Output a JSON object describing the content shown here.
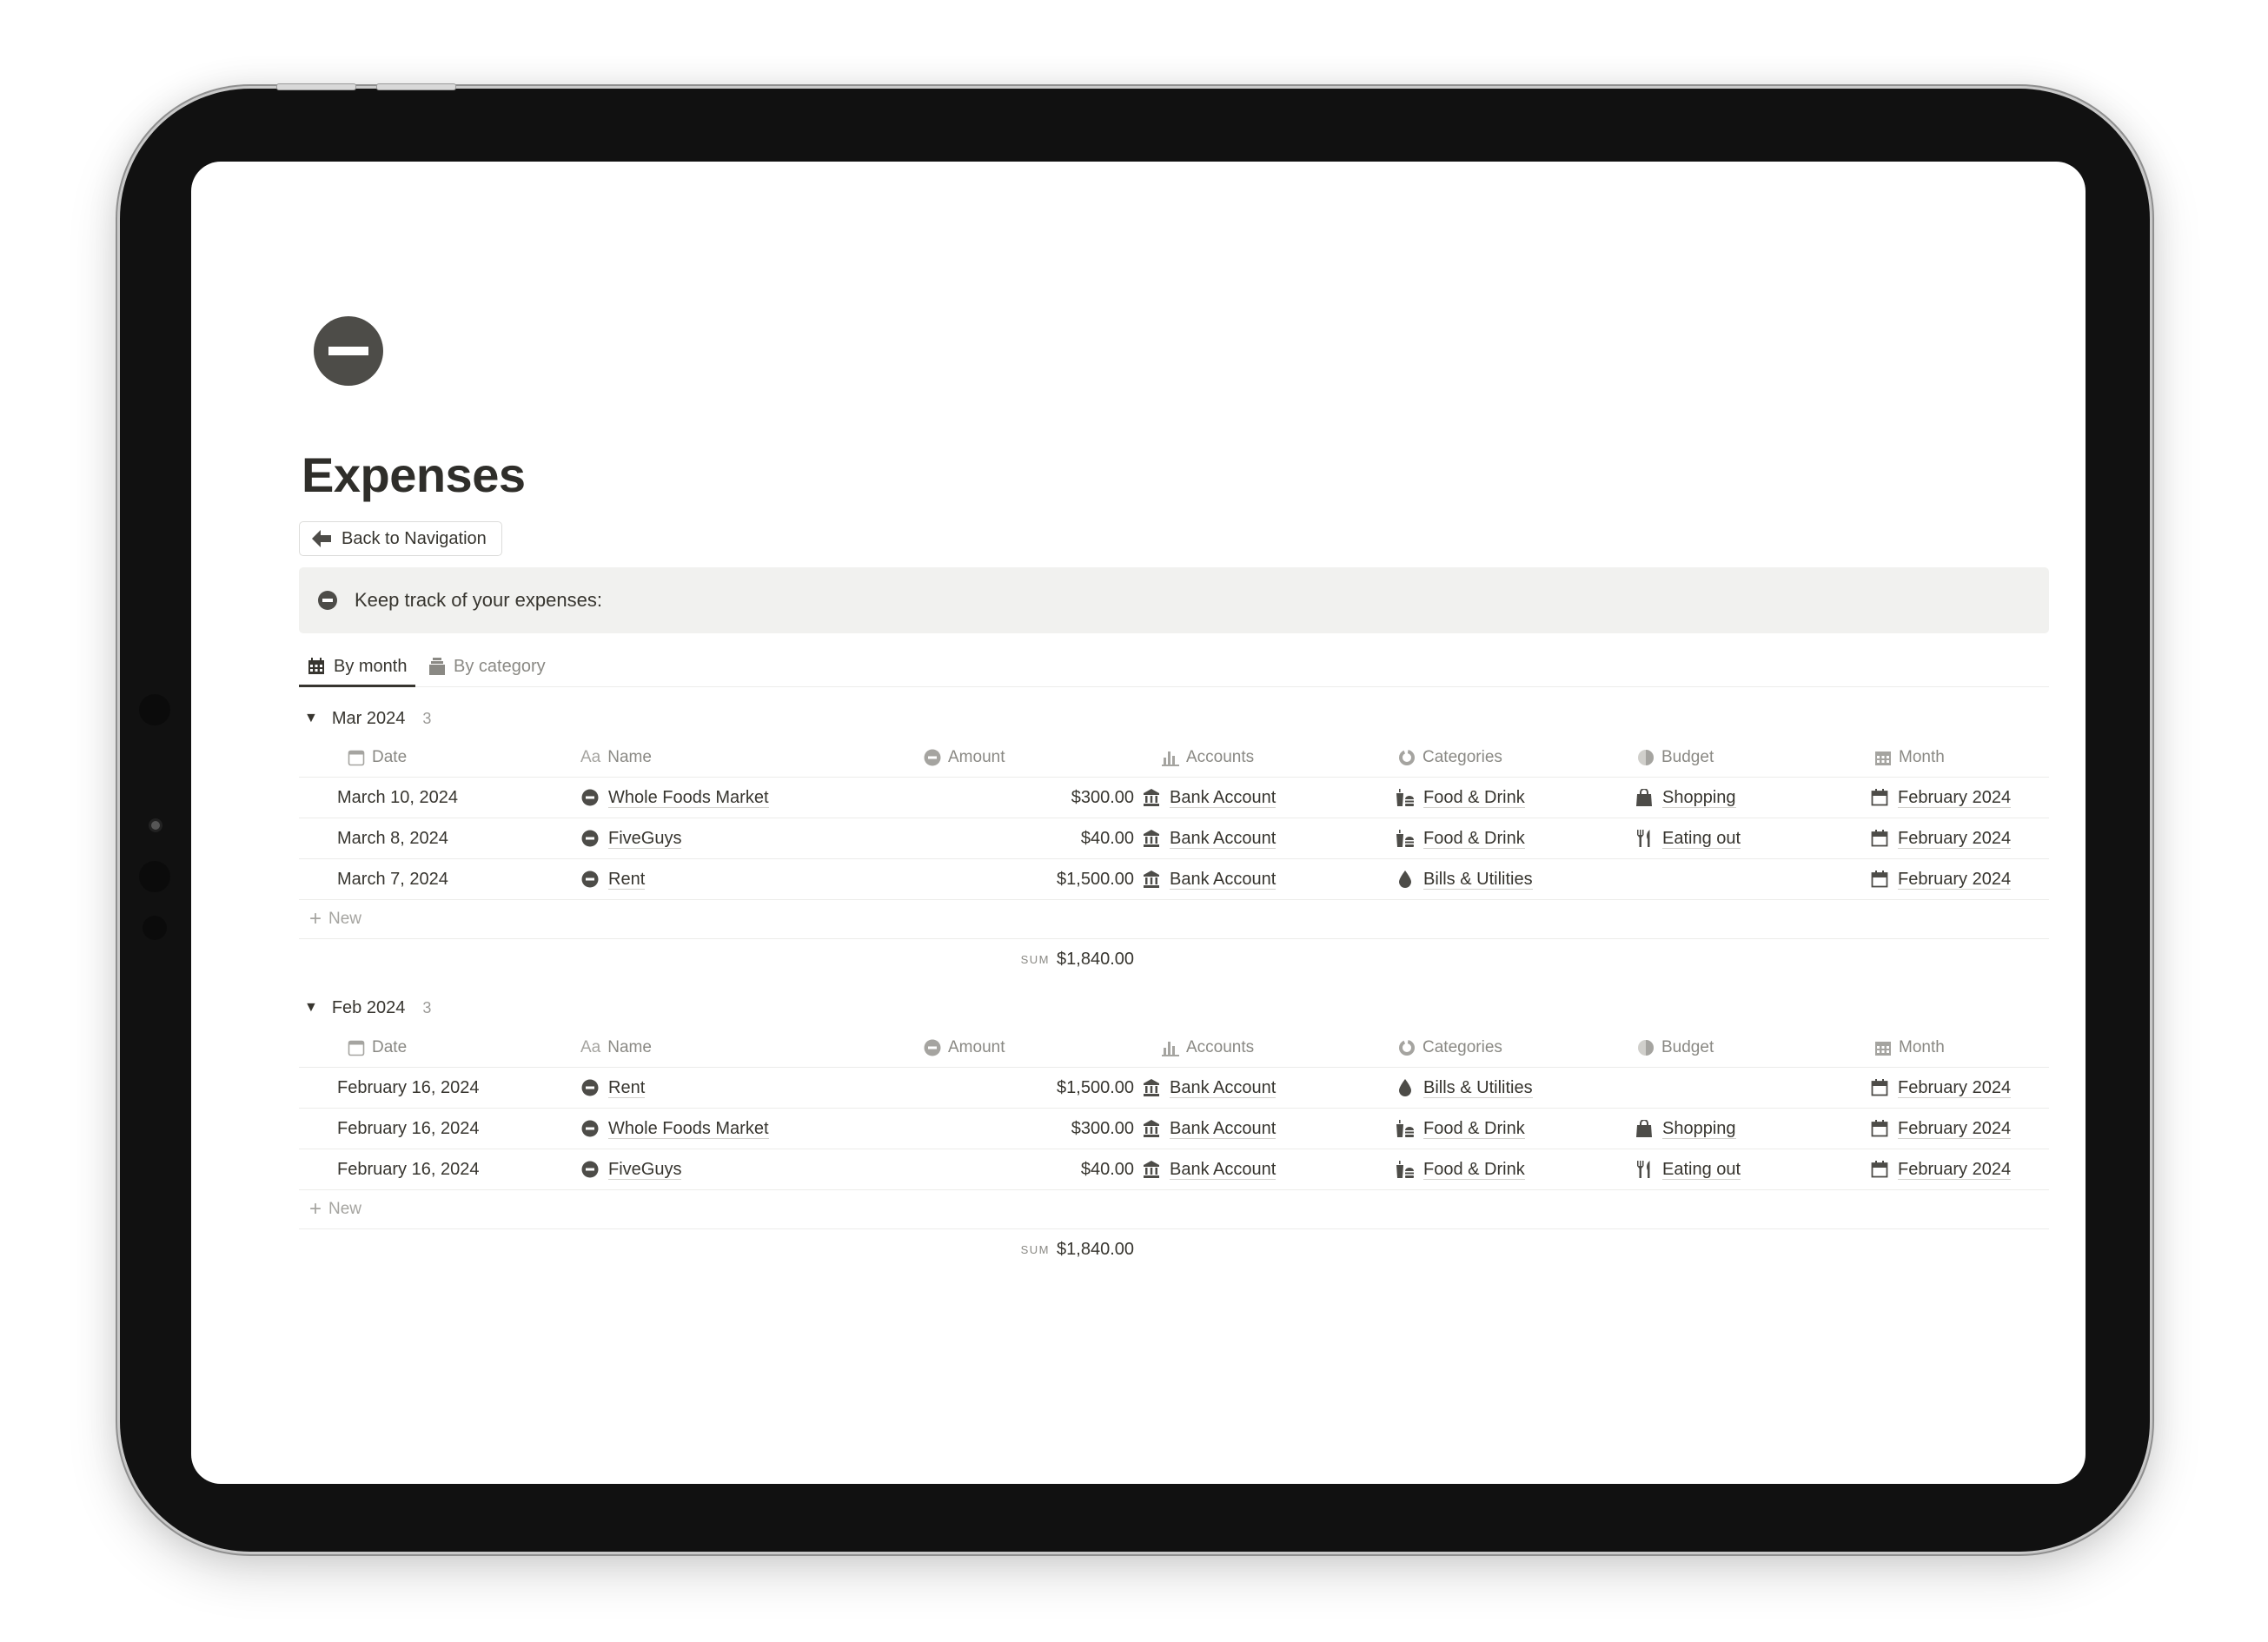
{
  "page": {
    "icon": "minus-circle-icon",
    "title": "Expenses",
    "back_button": "Back to Navigation",
    "callout": "Keep track of your expenses:"
  },
  "tabs": [
    {
      "label": "By month",
      "icon": "calendar-icon",
      "active": true
    },
    {
      "label": "By category",
      "icon": "stack-icon",
      "active": false
    }
  ],
  "columns": {
    "date": "Date",
    "name": "Name",
    "amount": "Amount",
    "accounts": "Accounts",
    "categories": "Categories",
    "budget": "Budget",
    "month": "Month"
  },
  "column_icons": {
    "date": "calendar-icon",
    "name": "text-aa-icon",
    "amount": "minus-circle-icon",
    "accounts": "bar-chart-icon",
    "categories": "pie-ring-icon",
    "budget": "half-circle-icon",
    "month": "calendar-grid-icon"
  },
  "new_label": "New",
  "sum_label": "SUM",
  "groups": [
    {
      "label": "Mar 2024",
      "count": "3",
      "sum": "$1,840.00",
      "rows": [
        {
          "date": "March 10, 2024",
          "name": "Whole Foods Market",
          "amount": "$300.00",
          "account": "Bank Account",
          "category": "Food & Drink",
          "category_icon": "food-drink-icon",
          "budget": "Shopping",
          "budget_icon": "shopping-bag-icon",
          "month": "February 2024"
        },
        {
          "date": "March 8, 2024",
          "name": "FiveGuys",
          "amount": "$40.00",
          "account": "Bank Account",
          "category": "Food & Drink",
          "category_icon": "food-drink-icon",
          "budget": "Eating out",
          "budget_icon": "fork-knife-icon",
          "month": "February 2024"
        },
        {
          "date": "March 7, 2024",
          "name": "Rent",
          "amount": "$1,500.00",
          "account": "Bank Account",
          "category": "Bills & Utilities",
          "category_icon": "water-drop-icon",
          "budget": "",
          "budget_icon": "",
          "month": "February 2024"
        }
      ]
    },
    {
      "label": "Feb 2024",
      "count": "3",
      "sum": "$1,840.00",
      "rows": [
        {
          "date": "February 16, 2024",
          "name": "Rent",
          "amount": "$1,500.00",
          "account": "Bank Account",
          "category": "Bills & Utilities",
          "category_icon": "water-drop-icon",
          "budget": "",
          "budget_icon": "",
          "month": "February 2024"
        },
        {
          "date": "February 16, 2024",
          "name": "Whole Foods Market",
          "amount": "$300.00",
          "account": "Bank Account",
          "category": "Food & Drink",
          "category_icon": "food-drink-icon",
          "budget": "Shopping",
          "budget_icon": "shopping-bag-icon",
          "month": "February 2024"
        },
        {
          "date": "February 16, 2024",
          "name": "FiveGuys",
          "amount": "$40.00",
          "account": "Bank Account",
          "category": "Food & Drink",
          "category_icon": "food-drink-icon",
          "budget": "Eating out",
          "budget_icon": "fork-knife-icon",
          "month": "February 2024"
        }
      ]
    }
  ]
}
